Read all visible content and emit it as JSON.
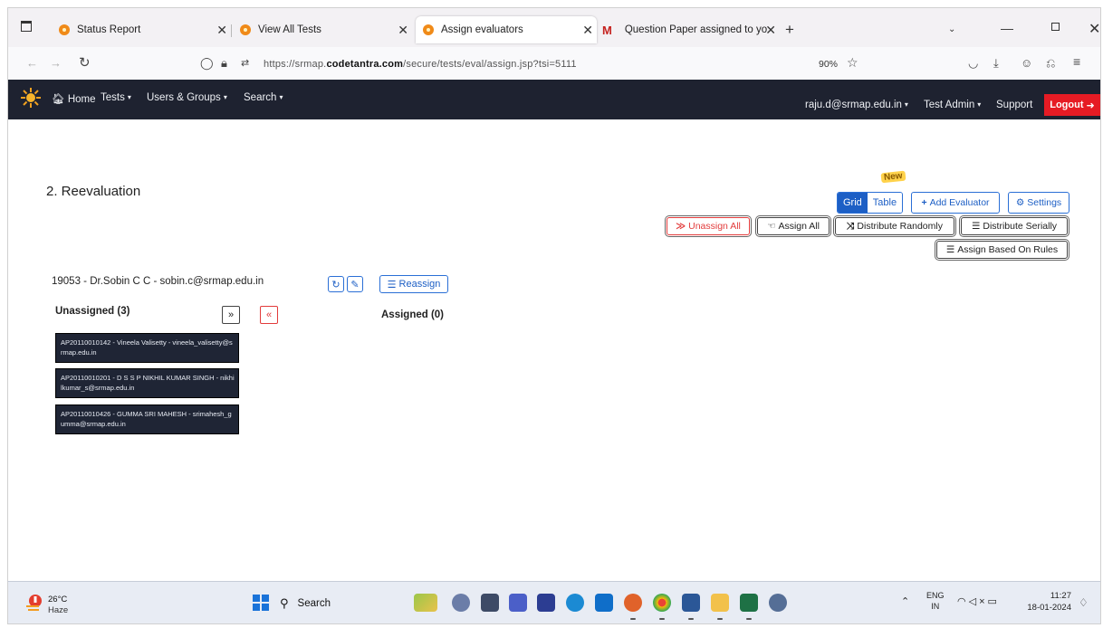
{
  "browser": {
    "tabs": [
      {
        "label": "Status Report",
        "active": false
      },
      {
        "label": "View All Tests",
        "active": false
      },
      {
        "label": "Assign evaluators",
        "active": true
      },
      {
        "label": "Question Paper assigned to yo",
        "active": false
      }
    ],
    "url_prefix": "https://srmap.",
    "url_domain": "codetantra.com",
    "url_path": "/secure/tests/eval/assign.jsp?tsi=5111",
    "zoom": "90%"
  },
  "header": {
    "menu": [
      "Home",
      "Tests",
      "Users & Groups",
      "Search"
    ],
    "user_email": "raju.d@srmap.edu.in",
    "role": "Test Admin",
    "support": "Support",
    "logout": "Logout"
  },
  "page": {
    "title": "2. Reevaluation",
    "new_badge": "New",
    "view_grid": "Grid",
    "view_table": "Table",
    "add_evaluator": "Add Evaluator",
    "settings": "Settings",
    "unassign_all": "Unassign All",
    "assign_all": "Assign All",
    "distribute_randomly": "Distribute Randomly",
    "distribute_serially": "Distribute Serially",
    "assign_rules": "Assign Based On Rules",
    "evaluator": "19053 - Dr.Sobin C C - sobin.c@srmap.edu.in",
    "reassign": "Reassign",
    "unassigned_heading": "Unassigned (3)",
    "assigned_heading": "Assigned (0)",
    "students": [
      "AP20110010142 - Vineela Valisetty - vineela_valisetty@srmap.edu.in",
      "AP20110010201 - D S S P NIKHIL KUMAR SINGH - nikhilkumar_s@srmap.edu.in",
      "AP20110010426 - GUMMA SRI MAHESH - srimahesh_gumma@srmap.edu.in"
    ]
  },
  "taskbar": {
    "temperature": "26°C",
    "condition": "Haze",
    "search": "Search",
    "lang_top": "ENG",
    "lang_bottom": "IN",
    "time": "11:27",
    "date": "18-01-2024"
  },
  "colors": {
    "header_bg": "#1e2230",
    "logout_red": "#e61b24",
    "primary_blue": "#1d5fc5",
    "card_bg": "#1f2535"
  }
}
